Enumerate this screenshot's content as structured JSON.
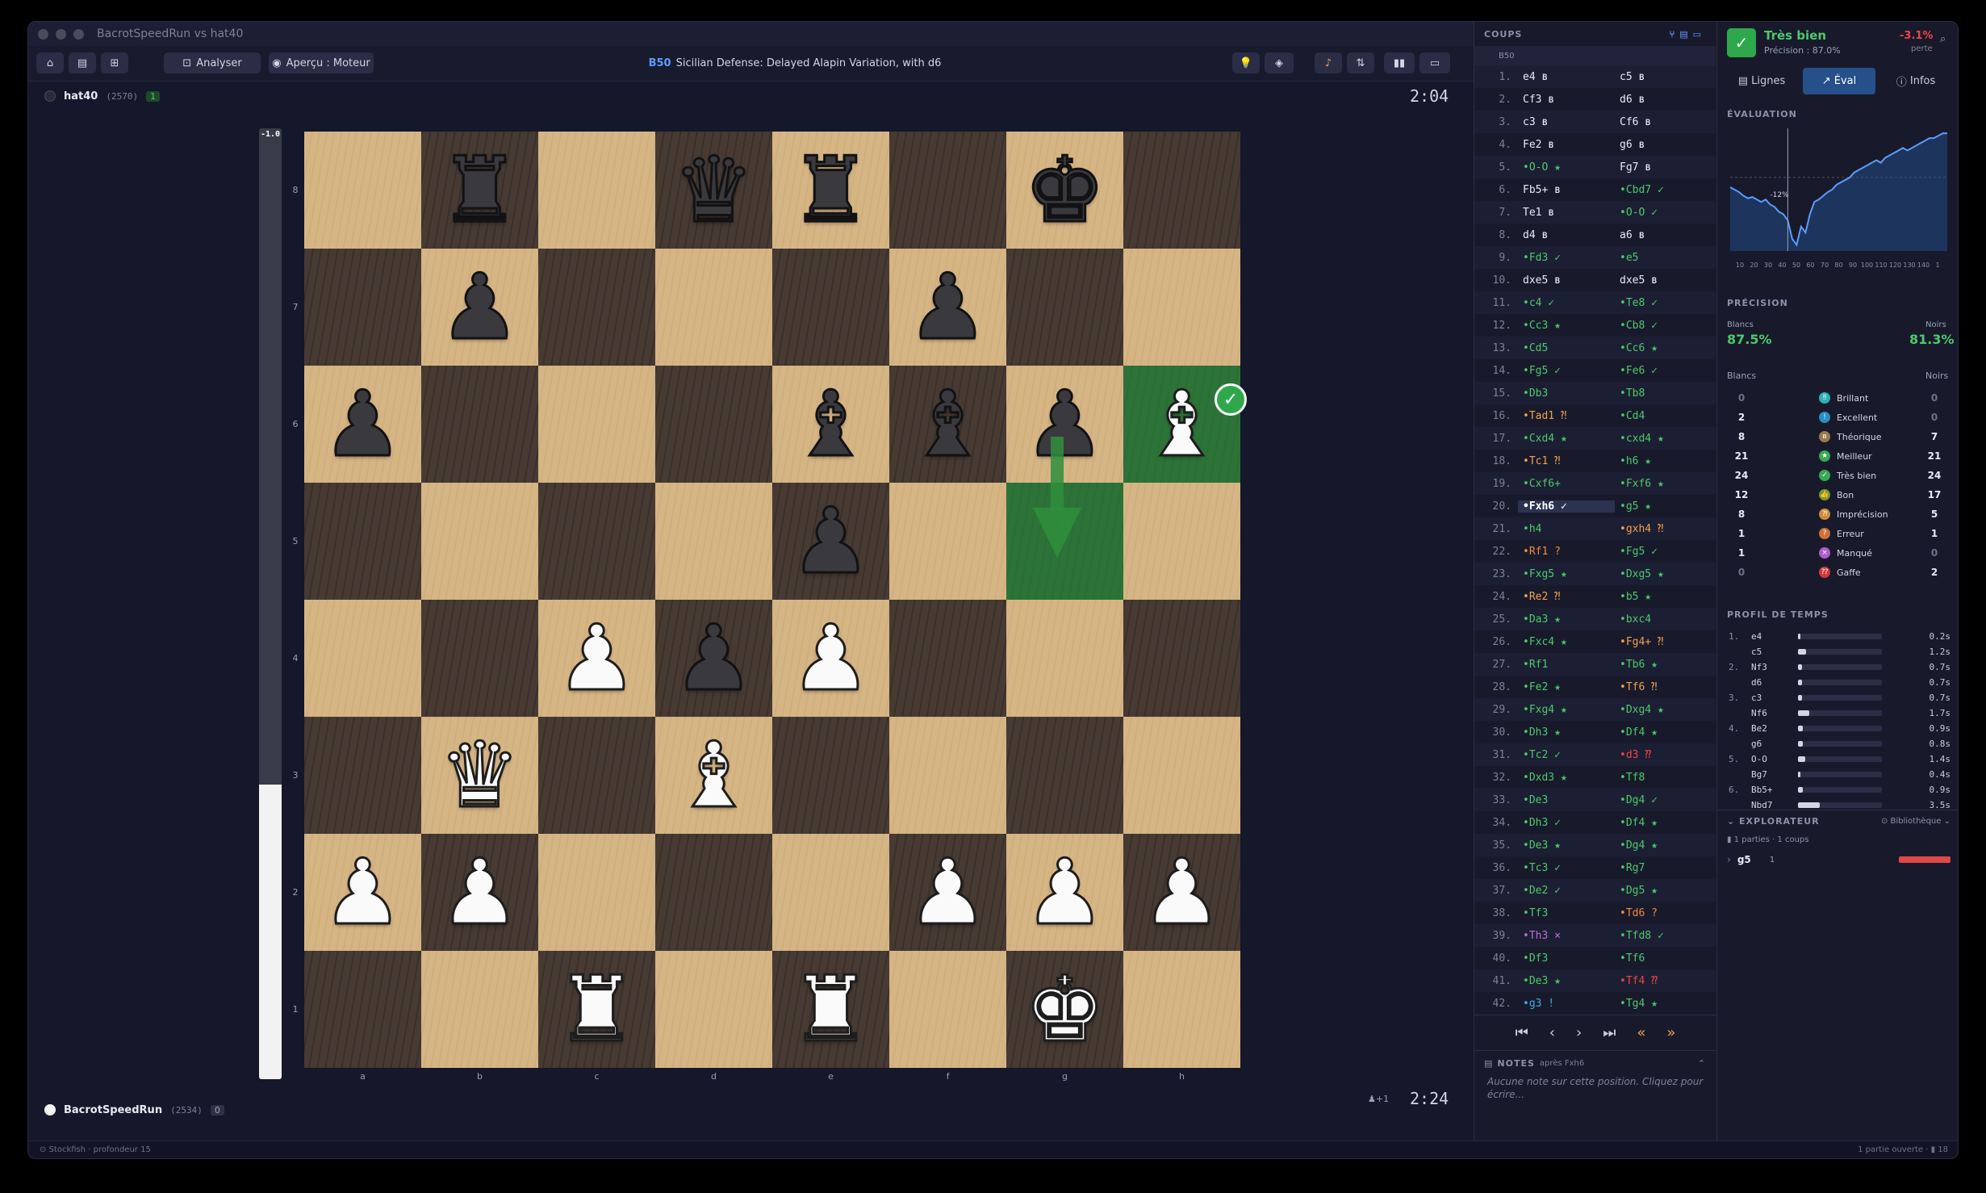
{
  "window": {
    "title": "BacrotSpeedRun vs hat40"
  },
  "toolbar": {
    "analyze_label": "Analyser",
    "preview_label": "Aperçu : Moteur",
    "eco": "B50",
    "opening": "Sicilian Defense: Delayed Alapin Variation, with d6"
  },
  "top_player": {
    "name": "hat40",
    "rating": "(2570)",
    "badge": "1",
    "clock": "2:04"
  },
  "bottom_player": {
    "name": "BacrotSpeedRun",
    "rating": "(2534)",
    "badge": "0",
    "clock": "2:24",
    "material": "♟+1"
  },
  "eval_bar": {
    "label": "-1.0",
    "white_fraction": 0.31
  },
  "board": {
    "ranks": [
      "8",
      "7",
      "6",
      "5",
      "4",
      "3",
      "2",
      "1"
    ],
    "files": [
      "a",
      "b",
      "c",
      "d",
      "e",
      "f",
      "g",
      "h"
    ],
    "rows": [
      [
        "",
        "bR",
        "",
        "bQ",
        "bR",
        "",
        "bK",
        ""
      ],
      [
        "",
        "bP",
        "",
        "",
        "",
        "bP",
        "",
        ""
      ],
      [
        "bP",
        "",
        "",
        "",
        "bB",
        "bB",
        "bP",
        "wB"
      ],
      [
        "",
        "",
        "",
        "",
        "bP",
        "",
        "",
        ""
      ],
      [
        "",
        "",
        "wP",
        "bP",
        "wP",
        "",
        "",
        ""
      ],
      [
        "",
        "wQ",
        "",
        "wB",
        "",
        "",
        "",
        ""
      ],
      [
        "wP",
        "wP",
        "",
        "",
        "",
        "wP",
        "wP",
        "wP"
      ],
      [
        "",
        "",
        "wR",
        "",
        "wR",
        "",
        "wK",
        ""
      ]
    ],
    "highlighted": [
      "h6",
      "g5"
    ],
    "arrow": {
      "from": "g6",
      "to": "g5",
      "color": "#2f8f3c"
    },
    "last_move_badge": "✓"
  },
  "moves_panel": {
    "title": "COUPS",
    "eco": "B50",
    "current_move_index": 19,
    "moves": [
      {
        "n": "1.",
        "w": "e4 ʙ",
        "wc": "#e8eaf2",
        "b": "c5 ʙ",
        "bc": "#e8eaf2"
      },
      {
        "n": "2.",
        "w": "Cf3 ʙ",
        "wc": "#e8eaf2",
        "b": "d6 ʙ",
        "bc": "#e8eaf2"
      },
      {
        "n": "3.",
        "w": "c3 ʙ",
        "wc": "#e8eaf2",
        "b": "Cf6 ʙ",
        "bc": "#e8eaf2"
      },
      {
        "n": "4.",
        "w": "Fe2 ʙ",
        "wc": "#e8eaf2",
        "b": "g6 ʙ",
        "bc": "#e8eaf2"
      },
      {
        "n": "5.",
        "w": "•O-O ★",
        "wc": "#4cc96a",
        "b": "Fg7 ʙ",
        "bc": "#e8eaf2"
      },
      {
        "n": "6.",
        "w": "Fb5+ ʙ",
        "wc": "#e8eaf2",
        "b": "•Cbd7 ✓",
        "bc": "#4cc96a"
      },
      {
        "n": "7.",
        "w": "Te1 ʙ",
        "wc": "#e8eaf2",
        "b": "•O-O ✓",
        "bc": "#4cc96a"
      },
      {
        "n": "8.",
        "w": "d4 ʙ",
        "wc": "#e8eaf2",
        "b": "a6 ʙ",
        "bc": "#e8eaf2"
      },
      {
        "n": "9.",
        "w": "•Fd3 ✓",
        "wc": "#4cc96a",
        "b": "•e5",
        "bc": "#4cc96a"
      },
      {
        "n": "10.",
        "w": "dxe5 ʙ",
        "wc": "#e8eaf2",
        "b": "dxe5 ʙ",
        "bc": "#e8eaf2"
      },
      {
        "n": "11.",
        "w": "•c4 ✓",
        "wc": "#4cc96a",
        "b": "•Te8 ✓",
        "bc": "#4cc96a"
      },
      {
        "n": "12.",
        "w": "•Cc3 ★",
        "wc": "#4cc96a",
        "b": "•Cb8 ✓",
        "bc": "#4cc96a"
      },
      {
        "n": "13.",
        "w": "•Cd5",
        "wc": "#4cc96a",
        "b": "•Cc6 ★",
        "bc": "#4cc96a"
      },
      {
        "n": "14.",
        "w": "•Fg5 ✓",
        "wc": "#4cc96a",
        "b": "•Fe6 ✓",
        "bc": "#4cc96a"
      },
      {
        "n": "15.",
        "w": "•Db3",
        "wc": "#4cc96a",
        "b": "•Tb8",
        "bc": "#4cc96a"
      },
      {
        "n": "16.",
        "w": "•Tad1 ⁈",
        "wc": "#f0a24a",
        "b": "•Cd4",
        "bc": "#4cc96a"
      },
      {
        "n": "17.",
        "w": "•Cxd4 ★",
        "wc": "#4cc96a",
        "b": "•cxd4 ★",
        "bc": "#4cc96a"
      },
      {
        "n": "18.",
        "w": "•Tc1 ⁈",
        "wc": "#f0a24a",
        "b": "•h6 ★",
        "bc": "#4cc96a"
      },
      {
        "n": "19.",
        "w": "•Cxf6+",
        "wc": "#4cc96a",
        "b": "•Fxf6 ★",
        "bc": "#4cc96a"
      },
      {
        "n": "20.",
        "w": "•Fxh6 ✓",
        "wc": "#ffffff",
        "b": "•g5 ★",
        "bc": "#4cc96a"
      },
      {
        "n": "21.",
        "w": "•h4",
        "wc": "#4cc96a",
        "b": "•gxh4 ⁈",
        "bc": "#f0a24a"
      },
      {
        "n": "22.",
        "w": "•Rf1 ?",
        "wc": "#f08a3a",
        "b": "•Fg5 ✓",
        "bc": "#4cc96a"
      },
      {
        "n": "23.",
        "w": "•Fxg5 ★",
        "wc": "#4cc96a",
        "b": "•Dxg5 ★",
        "bc": "#4cc96a"
      },
      {
        "n": "24.",
        "w": "•Re2 ⁈",
        "wc": "#f0a24a",
        "b": "•b5 ★",
        "bc": "#4cc96a"
      },
      {
        "n": "25.",
        "w": "•Da3 ★",
        "wc": "#4cc96a",
        "b": "•bxc4",
        "bc": "#4cc96a"
      },
      {
        "n": "26.",
        "w": "•Fxc4 ★",
        "wc": "#4cc96a",
        "b": "•Fg4+ ⁈",
        "bc": "#f0a24a"
      },
      {
        "n": "27.",
        "w": "•Rf1",
        "wc": "#4cc96a",
        "b": "•Tb6 ★",
        "bc": "#4cc96a"
      },
      {
        "n": "28.",
        "w": "•Fe2 ★",
        "wc": "#4cc96a",
        "b": "•Tf6 ⁈",
        "bc": "#f0a24a"
      },
      {
        "n": "29.",
        "w": "•Fxg4 ★",
        "wc": "#4cc96a",
        "b": "•Dxg4 ★",
        "bc": "#4cc96a"
      },
      {
        "n": "30.",
        "w": "•Dh3 ★",
        "wc": "#4cc96a",
        "b": "•Df4 ★",
        "bc": "#4cc96a"
      },
      {
        "n": "31.",
        "w": "•Tc2 ✓",
        "wc": "#4cc96a",
        "b": "•d3 ⁇",
        "bc": "#ef4444"
      },
      {
        "n": "32.",
        "w": "•Dxd3 ★",
        "wc": "#4cc96a",
        "b": "•Tf8",
        "bc": "#4cc96a"
      },
      {
        "n": "33.",
        "w": "•De3",
        "wc": "#4cc96a",
        "b": "•Dg4 ✓",
        "bc": "#4cc96a"
      },
      {
        "n": "34.",
        "w": "•Dh3 ✓",
        "wc": "#4cc96a",
        "b": "•Df4 ★",
        "bc": "#4cc96a"
      },
      {
        "n": "35.",
        "w": "•De3 ★",
        "wc": "#4cc96a",
        "b": "•Dg4 ★",
        "bc": "#4cc96a"
      },
      {
        "n": "36.",
        "w": "•Tc3 ✓",
        "wc": "#4cc96a",
        "b": "•Rg7",
        "bc": "#4cc96a"
      },
      {
        "n": "37.",
        "w": "•De2 ✓",
        "wc": "#4cc96a",
        "b": "•Dg5 ★",
        "bc": "#4cc96a"
      },
      {
        "n": "38.",
        "w": "•Tf3",
        "wc": "#4cc96a",
        "b": "•Td6 ?",
        "bc": "#f08a3a"
      },
      {
        "n": "39.",
        "w": "•Th3 ×",
        "wc": "#c06bd8",
        "b": "•Tfd8 ✓",
        "bc": "#4cc96a"
      },
      {
        "n": "40.",
        "w": "•Df3",
        "wc": "#4cc96a",
        "b": "•Tf6",
        "bc": "#4cc96a"
      },
      {
        "n": "41.",
        "w": "•De3 ★",
        "wc": "#4cc96a",
        "b": "•Tf4 ⁇",
        "bc": "#ef4444"
      },
      {
        "n": "42.",
        "w": "•g3 !",
        "wc": "#3ab0e8",
        "b": "•Tg4 ★",
        "bc": "#4cc96a"
      }
    ]
  },
  "notes": {
    "title": "NOTES",
    "context": "après Fxh6",
    "text": "Aucune note sur cette position. Cliquez pour écrire..."
  },
  "summary": {
    "label": "Très bien",
    "precision": "Précision : 87.0%",
    "delta": "-3.1%",
    "delta_caption": "perte"
  },
  "tabs": {
    "lines": "Lignes",
    "eval": "Éval",
    "infos": "Infos"
  },
  "evaluation": {
    "title": "ÉVALUATION",
    "marker": "-12%",
    "ticks": [
      "10",
      "20",
      "30",
      "40",
      "50",
      "60",
      "70",
      "80",
      "90",
      "100",
      "110",
      "120",
      "130",
      "140",
      "1"
    ],
    "series": [
      -8,
      -10,
      -12,
      -15,
      -17,
      -16,
      -18,
      -20,
      -18,
      -22,
      -24,
      -28,
      -30,
      -35,
      -50,
      -55,
      -40,
      -45,
      -30,
      -20,
      -18,
      -15,
      -12,
      -10,
      -6,
      -4,
      -2,
      0,
      4,
      6,
      8,
      10,
      12,
      14,
      12,
      16,
      18,
      20,
      22,
      24,
      22,
      24,
      26,
      28,
      30,
      32,
      32,
      34,
      36,
      36
    ]
  },
  "precision": {
    "title": "PRÉCISION",
    "white_label": "Blancs",
    "white_value": "87.5%",
    "black_label": "Noirs",
    "black_value": "81.3%"
  },
  "classification": {
    "white_header": "Blancs",
    "black_header": "Noirs",
    "rows": [
      {
        "name": "Brillant",
        "w": "0",
        "b": "0",
        "color": "#2bb3b3",
        "icon": "‼"
      },
      {
        "name": "Excellent",
        "w": "2",
        "b": "0",
        "color": "#2a8fc0",
        "icon": "!"
      },
      {
        "name": "Théorique",
        "w": "8",
        "b": "7",
        "color": "#9a7a4a",
        "icon": "ʙ"
      },
      {
        "name": "Meilleur",
        "w": "21",
        "b": "21",
        "color": "#3aa853",
        "icon": "★"
      },
      {
        "name": "Très bien",
        "w": "24",
        "b": "24",
        "color": "#3aa853",
        "icon": "✓"
      },
      {
        "name": "Bon",
        "w": "12",
        "b": "17",
        "color": "#6c9a3a",
        "icon": "👍"
      },
      {
        "name": "Imprécision",
        "w": "8",
        "b": "5",
        "color": "#d08a3a",
        "icon": "⁈"
      },
      {
        "name": "Erreur",
        "w": "1",
        "b": "1",
        "color": "#d0703a",
        "icon": "?"
      },
      {
        "name": "Manqué",
        "w": "1",
        "b": "0",
        "color": "#b05ad0",
        "icon": "×"
      },
      {
        "name": "Gaffe",
        "w": "0",
        "b": "2",
        "color": "#d03a3a",
        "icon": "⁇"
      }
    ]
  },
  "time_profile": {
    "title": "PROFIL DE TEMPS",
    "rows": [
      {
        "n": "1.",
        "m": "e4",
        "t": "0.2s",
        "frac": 0.03
      },
      {
        "n": "",
        "m": "c5",
        "t": "1.2s",
        "frac": 0.1
      },
      {
        "n": "2.",
        "m": "Nf3",
        "t": "0.7s",
        "frac": 0.05
      },
      {
        "n": "",
        "m": "d6",
        "t": "0.7s",
        "frac": 0.05
      },
      {
        "n": "3.",
        "m": "c3",
        "t": "0.7s",
        "frac": 0.05
      },
      {
        "n": "",
        "m": "Nf6",
        "t": "1.7s",
        "frac": 0.13
      },
      {
        "n": "4.",
        "m": "Be2",
        "t": "0.9s",
        "frac": 0.06
      },
      {
        "n": "",
        "m": "g6",
        "t": "0.8s",
        "frac": 0.06
      },
      {
        "n": "5.",
        "m": "O-O",
        "t": "1.4s",
        "frac": 0.09
      },
      {
        "n": "",
        "m": "Bg7",
        "t": "0.4s",
        "frac": 0.03
      },
      {
        "n": "6.",
        "m": "Bb5+",
        "t": "0.9s",
        "frac": 0.06
      },
      {
        "n": "",
        "m": "Nbd7",
        "t": "3.5s",
        "frac": 0.26
      }
    ]
  },
  "explorer": {
    "title": "EXPLORATEUR",
    "source": "Bibliothèque",
    "count": "1 parties · 1 coups",
    "move": "g5",
    "move_count": "1"
  },
  "statusbar": {
    "left": "Stockfish · profondeur 15",
    "right": "1 partie ouverte",
    "right_count": "18"
  }
}
